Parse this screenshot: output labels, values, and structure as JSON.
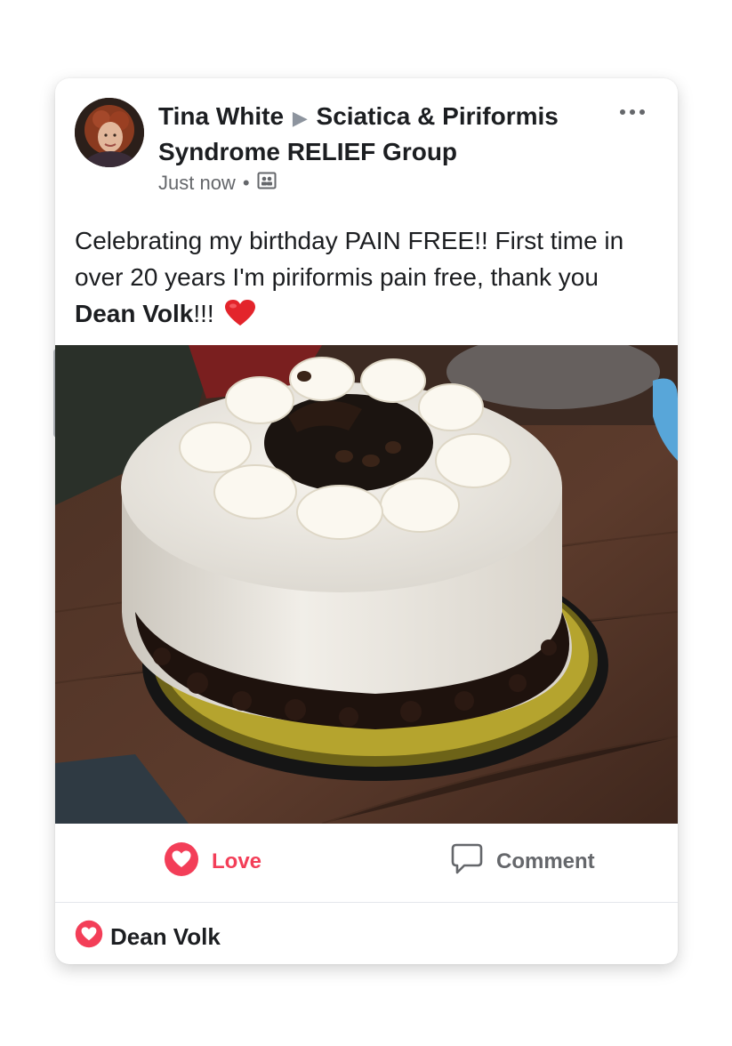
{
  "post": {
    "author": "Tina White",
    "group": "Sciatica & Piriformis Syndrome RELIEF Group",
    "time": "Just now",
    "time_separator": "•",
    "text_before": "Celebrating my birthday PAIN FREE!! First time in over 20 years I'm piriformis pain free, thank you ",
    "mention": "Dean Volk",
    "text_after": "!!!"
  },
  "actions": {
    "love_label": "Love",
    "comment_label": "Comment"
  },
  "reactions": {
    "names": "Dean Volk"
  },
  "colors": {
    "love": "#f33e58",
    "secondary_text": "#65676b",
    "primary_text": "#1c1e21"
  },
  "icons": [
    "more-options-icon",
    "audience-group-icon",
    "heart-emoji-icon",
    "love-reaction-icon",
    "comment-icon"
  ]
}
